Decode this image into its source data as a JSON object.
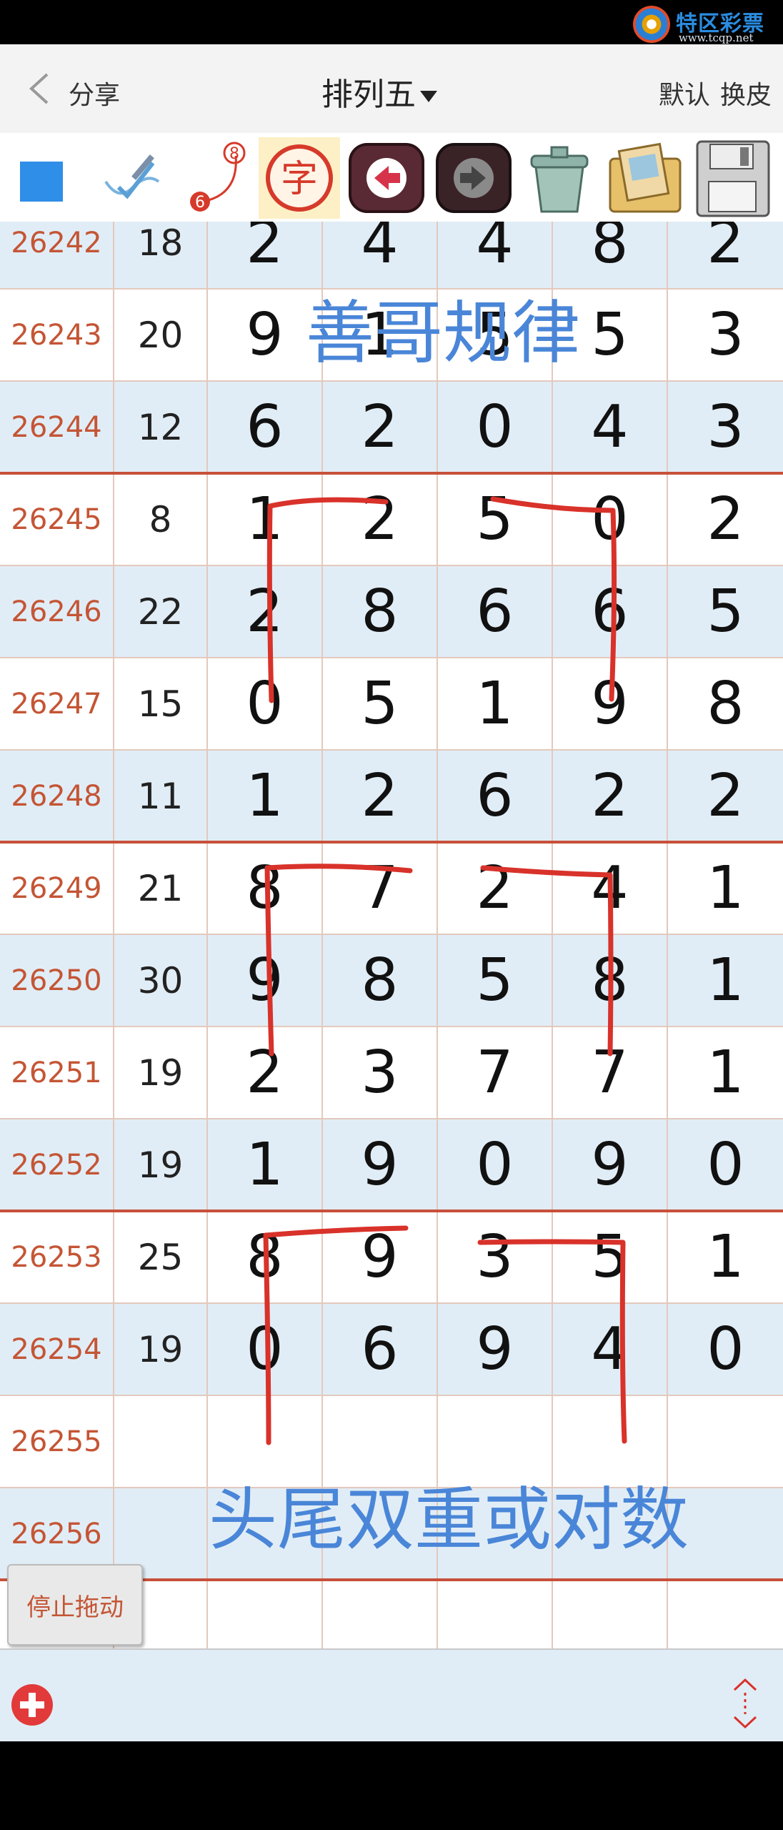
{
  "watermark": {
    "title": "特区彩票网",
    "url": "www.tcqp.net"
  },
  "header": {
    "back_label": "分享",
    "title": "排列五",
    "actions": [
      "默认",
      "换皮"
    ]
  },
  "toolbar": {
    "icons": [
      "blue-square-icon",
      "pen-check-icon",
      "numbered-curve-icon",
      "character-icon",
      "arrow-left-icon",
      "arrow-right-icon",
      "trash-can-icon",
      "photo-album-icon",
      "floppy-disk-icon"
    ],
    "curve_numbers": [
      "8",
      "6"
    ],
    "char_label": "字"
  },
  "rows": [
    {
      "issue": "26242",
      "sum": "18",
      "digits": [
        "2",
        "4",
        "4",
        "8",
        "2"
      ]
    },
    {
      "issue": "26243",
      "sum": "20",
      "digits": [
        "9",
        "1",
        "5",
        "5",
        "3"
      ]
    },
    {
      "issue": "26244",
      "sum": "12",
      "digits": [
        "6",
        "2",
        "0",
        "4",
        "3"
      ]
    },
    {
      "issue": "26245",
      "sum": "8",
      "digits": [
        "1",
        "2",
        "5",
        "0",
        "2"
      ]
    },
    {
      "issue": "26246",
      "sum": "22",
      "digits": [
        "2",
        "8",
        "6",
        "6",
        "5"
      ]
    },
    {
      "issue": "26247",
      "sum": "15",
      "digits": [
        "0",
        "5",
        "1",
        "9",
        "8"
      ]
    },
    {
      "issue": "26248",
      "sum": "11",
      "digits": [
        "1",
        "2",
        "6",
        "2",
        "2"
      ]
    },
    {
      "issue": "26249",
      "sum": "21",
      "digits": [
        "8",
        "7",
        "2",
        "4",
        "1"
      ]
    },
    {
      "issue": "26250",
      "sum": "30",
      "digits": [
        "9",
        "8",
        "5",
        "8",
        "1"
      ]
    },
    {
      "issue": "26251",
      "sum": "19",
      "digits": [
        "2",
        "3",
        "7",
        "7",
        "1"
      ]
    },
    {
      "issue": "26252",
      "sum": "19",
      "digits": [
        "1",
        "9",
        "0",
        "9",
        "0"
      ]
    },
    {
      "issue": "26253",
      "sum": "25",
      "digits": [
        "8",
        "9",
        "3",
        "5",
        "1"
      ]
    },
    {
      "issue": "26254",
      "sum": "19",
      "digits": [
        "0",
        "6",
        "9",
        "4",
        "0"
      ]
    },
    {
      "issue": "26255",
      "sum": "",
      "digits": [
        "",
        "",
        "",
        "",
        ""
      ]
    },
    {
      "issue": "26256",
      "sum": "",
      "digits": [
        "",
        "",
        "",
        "",
        ""
      ]
    },
    {
      "issue": "",
      "sum": "",
      "digits": [
        "",
        "",
        "",
        "",
        ""
      ]
    }
  ],
  "annotations": {
    "top_text": "善哥规律",
    "bottom_text": "头尾双重或对数",
    "color": "#4a86d8",
    "stroke_color": "#d8322a"
  },
  "stop_button": "停止拖动",
  "colors": {
    "issue": "#c45535",
    "alt_row": "#e1edf6",
    "group_line": "#c7503a"
  }
}
